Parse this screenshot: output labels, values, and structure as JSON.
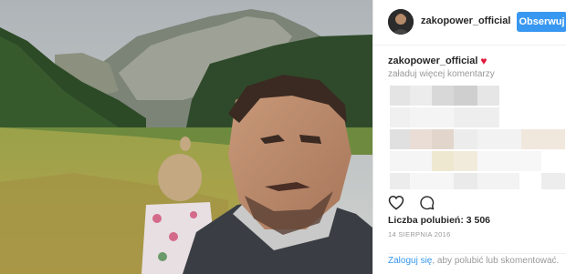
{
  "post": {
    "username": "zakopower_official",
    "follow_label": "Obserwuj",
    "caption_user": "zakopower_official",
    "caption_emoji": "♥",
    "load_more_comments": "załaduj więcej komentarzy",
    "likes_text": "Liczba polubień: 3 506",
    "date": "14 SIERPNIA 2016",
    "login_link": "Zaloguj się",
    "login_suffix": ", aby polubić lub skomentować."
  },
  "icons": {
    "like": "heart-icon",
    "comment": "comment-icon"
  },
  "colors": {
    "follow_button": "#3897f0",
    "link": "#3897f0",
    "muted_text": "#999999",
    "emoji_heart": "#e0183a"
  }
}
